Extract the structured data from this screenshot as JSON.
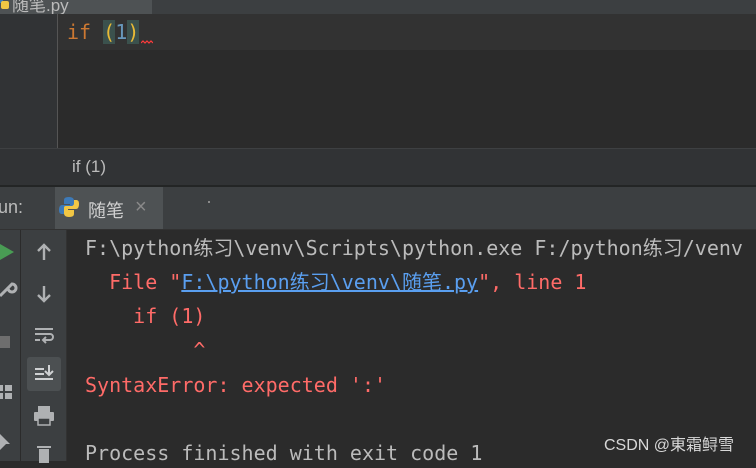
{
  "editor_tab": {
    "title": "随笔.py"
  },
  "code": {
    "keyword": "if",
    "open_paren": "(",
    "number": "1",
    "close_paren": ")"
  },
  "breadcrumb": "if (1)",
  "run_window": {
    "label": "un:",
    "tab_label": "随笔",
    "close_glyph": "×"
  },
  "console": {
    "command": "F:\\python练习\\venv\\Scripts\\python.exe F:/python练习/venv",
    "file_prefix": "  File \"",
    "file_link": "F:\\python练习\\venv\\随笔.py",
    "file_suffix": "\", line 1",
    "code_echo": "    if (1)",
    "caret": "         ^",
    "error": "SyntaxError: expected ':'",
    "exit": "Process finished with exit code 1"
  },
  "watermark": "CSDN @東霜鲟雪",
  "colors": {
    "background": "#2b2b2b",
    "error": "#ff6b68",
    "link": "#5a9ff0",
    "keyword": "#cc7832",
    "run_green": "#499c54"
  }
}
